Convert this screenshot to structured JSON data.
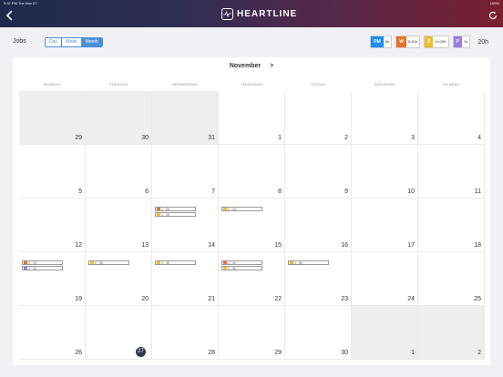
{
  "status": {
    "time": "3:37 PM",
    "date": "Tue Nov 27",
    "right": "100%"
  },
  "header": {
    "brand": "HEARTLINE"
  },
  "toolbar": {
    "jobs_label": "Jobs",
    "views": [
      "Day",
      "Week",
      "Month"
    ],
    "active_view": "Month"
  },
  "summary": {
    "chips": [
      {
        "badge": "PM",
        "value": "6h",
        "color": "#1d8ef0"
      },
      {
        "badge": "W",
        "value": "5:30h",
        "color": "#e8742a"
      },
      {
        "badge": "S",
        "value": "14:25h",
        "color": "#f0bf2b"
      },
      {
        "badge": "P",
        "value": "1h",
        "color": "#9c7be0"
      }
    ],
    "total": "20h"
  },
  "calendar": {
    "month": "November",
    "next": ">",
    "weekdays": [
      "MONDAY",
      "TUESDAY",
      "WEDNESDAY",
      "THURSDAY",
      "FRIDAY",
      "SATURDAY",
      "SUNDAY"
    ],
    "days": [
      {
        "n": "29",
        "out": true
      },
      {
        "n": "30",
        "out": true
      },
      {
        "n": "31",
        "out": true
      },
      {
        "n": "1"
      },
      {
        "n": "2"
      },
      {
        "n": "3"
      },
      {
        "n": "4"
      },
      {
        "n": "5"
      },
      {
        "n": "6"
      },
      {
        "n": "7"
      },
      {
        "n": "8"
      },
      {
        "n": "9"
      },
      {
        "n": "10"
      },
      {
        "n": "11"
      },
      {
        "n": "12"
      },
      {
        "n": "13"
      },
      {
        "n": "14",
        "events": [
          {
            "c": "#e8742a",
            "n": "1",
            "h": "2h"
          },
          {
            "c": "#f0bf2b",
            "n": "1",
            "h": "1h"
          }
        ]
      },
      {
        "n": "15",
        "events": [
          {
            "c": "#f0bf2b",
            "n": "1",
            "h": "1h"
          }
        ]
      },
      {
        "n": "16"
      },
      {
        "n": "17"
      },
      {
        "n": "18"
      },
      {
        "n": "19",
        "events": [
          {
            "c": "#e8742a",
            "n": "1",
            "h": "1h"
          },
          {
            "c": "#9c7be0",
            "n": "1",
            "h": "1h"
          }
        ]
      },
      {
        "n": "20",
        "events": [
          {
            "c": "#f0bf2b",
            "n": "2",
            "h": "3h"
          }
        ]
      },
      {
        "n": "21",
        "events": [
          {
            "c": "#f0bf2b",
            "n": "2",
            "h": "4h"
          }
        ]
      },
      {
        "n": "22",
        "events": [
          {
            "c": "#e8742a",
            "n": "1",
            "h": "2h"
          },
          {
            "c": "#f0bf2b",
            "n": "1",
            "h": "3h"
          }
        ]
      },
      {
        "n": "23",
        "events": [
          {
            "c": "#f0bf2b",
            "n": "1",
            "h": "6h"
          }
        ]
      },
      {
        "n": "24"
      },
      {
        "n": "25"
      },
      {
        "n": "26"
      },
      {
        "n": "27",
        "today": true
      },
      {
        "n": "28"
      },
      {
        "n": "29"
      },
      {
        "n": "30"
      },
      {
        "n": "1",
        "out": true
      },
      {
        "n": "2",
        "out": true
      }
    ]
  }
}
